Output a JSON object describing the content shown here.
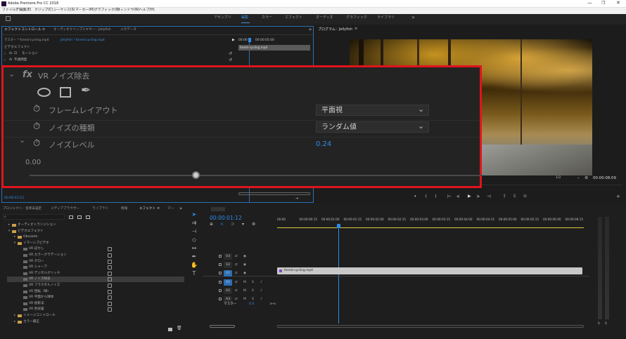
{
  "app": {
    "title": "Adobe Premiere Pro CC 2018"
  },
  "menu": [
    "ファイル(F)",
    "編集(E)",
    "クリップ(C)",
    "シーケンス(S)",
    "マーカー(M)",
    "グラフィック(G)",
    "ウィンドウ(W)",
    "ヘルプ(H)"
  ],
  "workspaces": {
    "items": [
      "アセンブリ",
      "編集",
      "カラー",
      "エフェクト",
      "オーディオ",
      "グラフィック",
      "ライブラリ"
    ],
    "active": "編集",
    "overflow": "»"
  },
  "effect_controls": {
    "tabs": [
      "エフェクトコントロール",
      "オーディオクリップミキサー：Jellyfish",
      "メタデータ"
    ],
    "master_label": "マスター * forest-cycling.mp4",
    "sequence_label": "Jellyfish * forest-cycling.mp4",
    "ruler": {
      "start": "00:00",
      "end": "00:00:05:00"
    },
    "clip_name": "forest-cycling.mp4",
    "section": "ビデオエフェクト",
    "rows": [
      "モーション",
      "不透明度"
    ],
    "timecode": "00:00:01:12"
  },
  "zoom": {
    "fx": "fx",
    "effect_name": "VR ノイズ除去",
    "params": [
      {
        "label": "フレームレイアウト",
        "value": "平面視"
      },
      {
        "label": "ノイズの種類",
        "value": "ランダム値"
      },
      {
        "label": "ノイズレベル",
        "value": "0.24"
      }
    ],
    "slider_min": "0.00",
    "slider_value": 0.24
  },
  "program": {
    "title": "プログラム：Jellyfish",
    "zoom_select": "1/2",
    "duration": "00:00:08:09",
    "buttons": [
      "▾",
      "{",
      "}",
      "|←",
      "◂|",
      "▶",
      "|▸",
      "→|"
    ]
  },
  "project": {
    "tabs": [
      "プロジェクト：名称未設定",
      "メディアブラウザー",
      "ライブラリ",
      "情報",
      "エフェクト",
      "マー"
    ],
    "tree": [
      {
        "label": "オーディオトランジション",
        "indent": 0,
        "twirl": "▸",
        "folder": true
      },
      {
        "label": "ビデオエフェクト",
        "indent": 0,
        "twirl": "▾",
        "folder": true
      },
      {
        "label": "Obsolete",
        "indent": 1,
        "twirl": "▸",
        "folder": true
      },
      {
        "label": "イマーシブビデオ",
        "indent": 1,
        "twirl": "▾",
        "folder": true
      },
      {
        "label": "VR ぼかし",
        "indent": 2,
        "box": true
      },
      {
        "label": "VR カラーグラデーション",
        "indent": 2,
        "box": true
      },
      {
        "label": "VR グロー",
        "indent": 2,
        "box": true
      },
      {
        "label": "VR シャープ",
        "indent": 2,
        "box": true
      },
      {
        "label": "VR デジタルグリッチ",
        "indent": 2,
        "box": true
      },
      {
        "label": "VR ノイズ除去",
        "indent": 2,
        "box": true,
        "selected": true
      },
      {
        "label": "VR フラクタルノイズ",
        "indent": 2,
        "box": true
      },
      {
        "label": "VR 回転（球）",
        "indent": 2,
        "box": true
      },
      {
        "label": "VR 平面から球体",
        "indent": 2,
        "box": true
      },
      {
        "label": "VR 投影法",
        "indent": 2,
        "box": true
      },
      {
        "label": "VR 色収差",
        "indent": 2,
        "box": true
      },
      {
        "label": "イメージコントロール",
        "indent": 1,
        "twirl": "▸",
        "folder": true
      },
      {
        "label": "カラー補正",
        "indent": 1,
        "twirl": "▸",
        "folder": true
      }
    ]
  },
  "timeline": {
    "timecode": "00:00:01:12",
    "ruler": [
      "00:00",
      "00:00:00:15",
      "00:00:01:00",
      "00:00:01:15",
      "00:00:02:00",
      "00:00:02:15",
      "00:00:03:00",
      "00:00:03:15",
      "00:00:04:00",
      "00:00:04:15",
      "00:00:05:00",
      "00:00:05:15",
      "00:00:06:00",
      "00:00:06:15"
    ],
    "tracks": [
      {
        "name": "V3",
        "type": "video"
      },
      {
        "name": "V2",
        "type": "video"
      },
      {
        "name": "V1",
        "type": "video",
        "target": true
      },
      {
        "name": "A1",
        "type": "audio",
        "target": true
      },
      {
        "name": "A2",
        "type": "audio"
      },
      {
        "name": "A3",
        "type": "audio"
      }
    ],
    "master": {
      "label": "マスター",
      "value": "0.0"
    },
    "clip": "forest-cycling.mp4"
  },
  "meter": {
    "bottom": [
      "S",
      "S"
    ]
  }
}
